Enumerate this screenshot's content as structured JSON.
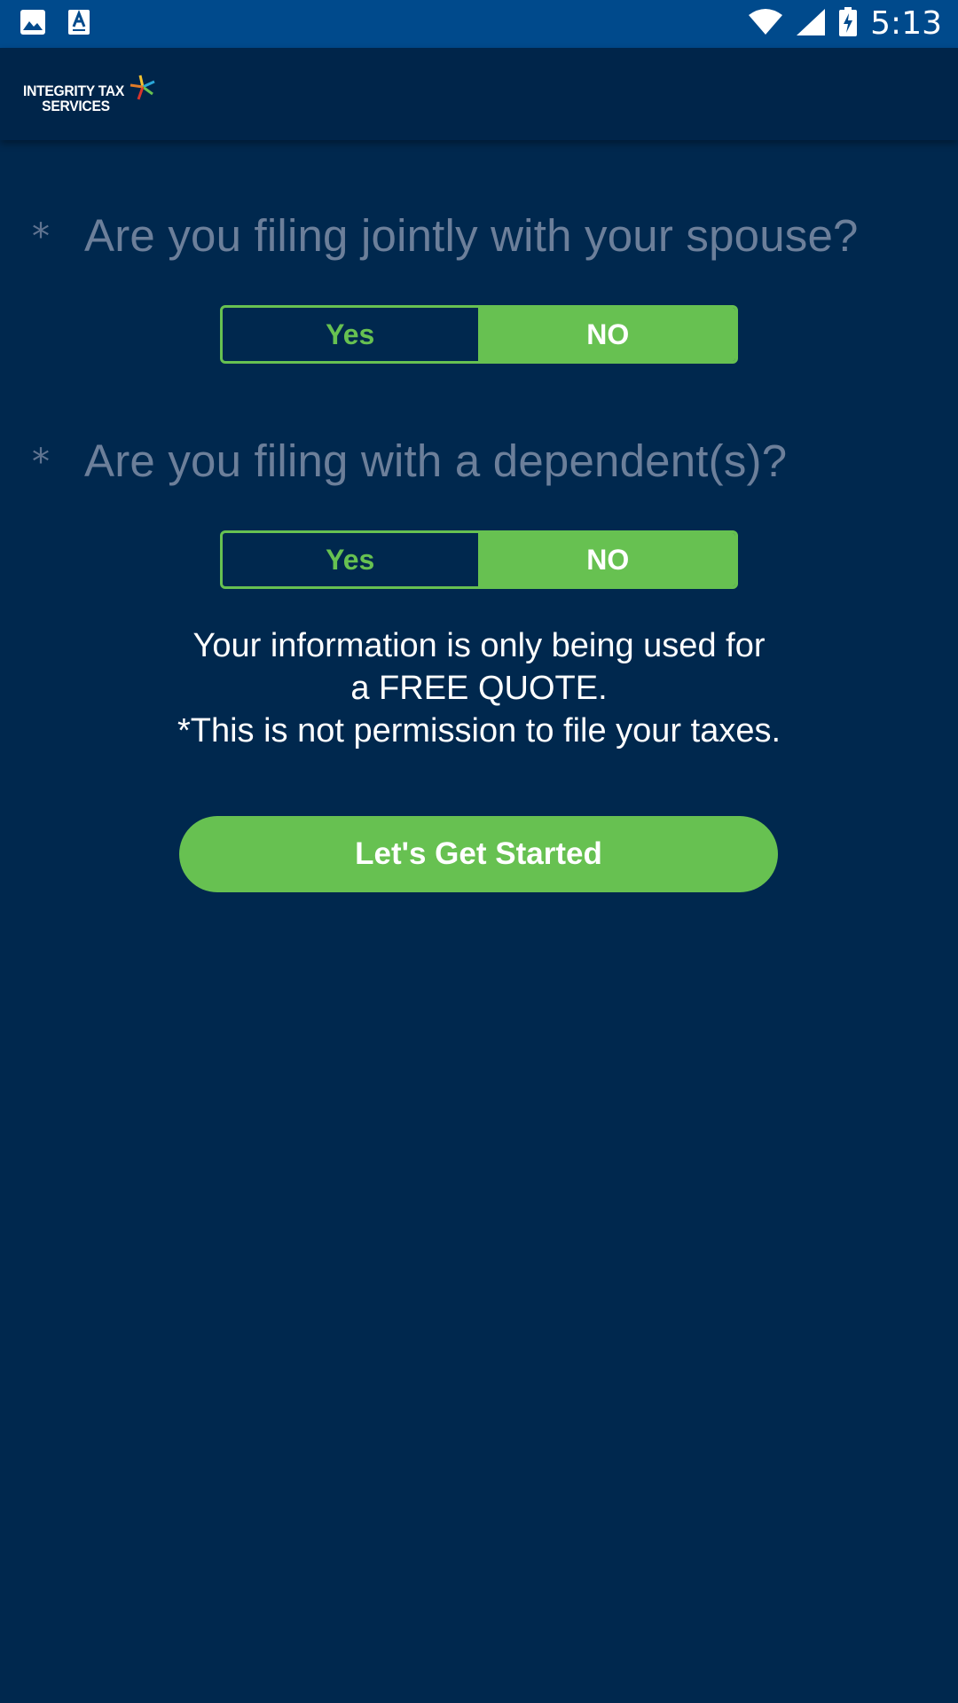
{
  "status_bar": {
    "time": "5:13",
    "left_icons": [
      "image-icon",
      "font-icon"
    ],
    "right_icons": [
      "wifi-icon",
      "signal-icon",
      "battery-charging-icon"
    ]
  },
  "header": {
    "logo_line1": "INTEGRITY TAX",
    "logo_line2": "SERVICES"
  },
  "questions": [
    {
      "required_mark": "*",
      "text": "Are you filing jointly with your spouse?",
      "options": [
        "Yes",
        "NO"
      ],
      "selected": "NO"
    },
    {
      "required_mark": "*",
      "text": "Are you filing with a dependent(s)?",
      "options": [
        "Yes",
        "NO"
      ],
      "selected": "NO"
    }
  ],
  "info": {
    "line1": "Your information is only being used for",
    "line2": "a FREE QUOTE.",
    "line3": "*This is not permission to file your taxes."
  },
  "cta": {
    "label": "Let's Get Started"
  },
  "colors": {
    "background": "#00284e",
    "status_bar": "#004a8c",
    "header": "#00254a",
    "accent_green": "#67c151",
    "question_text": "#6c7f9a"
  }
}
